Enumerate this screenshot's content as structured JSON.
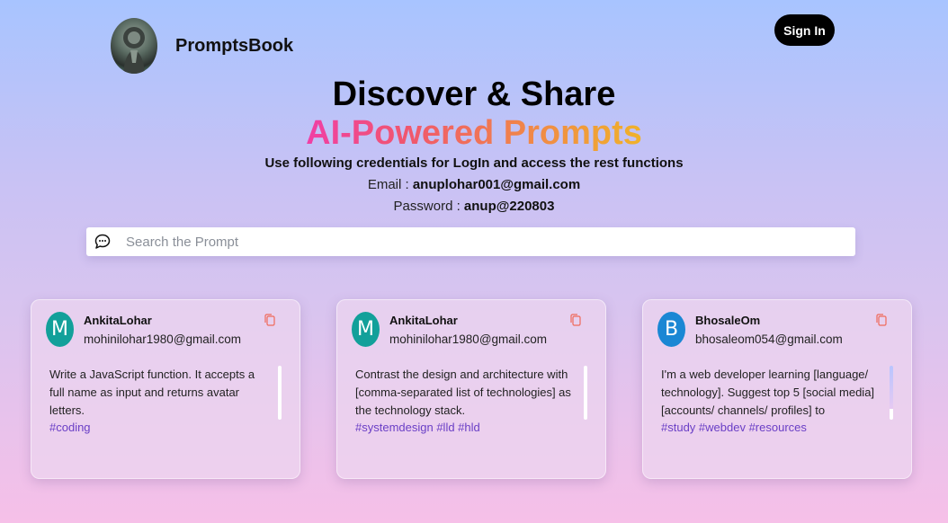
{
  "header": {
    "brand": "PromptsBook",
    "sign_in": "Sign In"
  },
  "hero": {
    "title": "Discover & Share",
    "subtitle": "AI-Powered Prompts",
    "note": "Use following credentials for LogIn and access the rest functions",
    "email_label": "Email : ",
    "email_value": "anuplohar001@gmail.com",
    "password_label": "Password : ",
    "password_value": "anup@220803"
  },
  "search": {
    "placeholder": "Search the Prompt",
    "value": ""
  },
  "colors": {
    "avatar_1": "#12a09a",
    "avatar_2": "#12a09a",
    "avatar_3": "#1a87d4",
    "copy_icon": "#f06a5a",
    "tag": "#6a3fc6"
  },
  "cards": [
    {
      "initial": "M",
      "name": "AnkitaLohar",
      "email": "mohinilohar1980@gmail.com",
      "text": "Write a JavaScript function. It accepts a full name as input and returns avatar letters.",
      "tags": "#coding"
    },
    {
      "initial": "M",
      "name": "AnkitaLohar",
      "email": "mohinilohar1980@gmail.com",
      "text": "Contrast the design and architecture with [comma-separated list of technologies] as the technology stack.",
      "tags": "#systemdesign #lld #hld"
    },
    {
      "initial": "B",
      "name": "BhosaleOm",
      "email": "bhosaleom054@gmail.com",
      "text": "I'm a web developer learning [language/ technology]. Suggest top 5 [social media] [accounts/ channels/ profiles] to",
      "tags": "#study #webdev #resources"
    }
  ]
}
